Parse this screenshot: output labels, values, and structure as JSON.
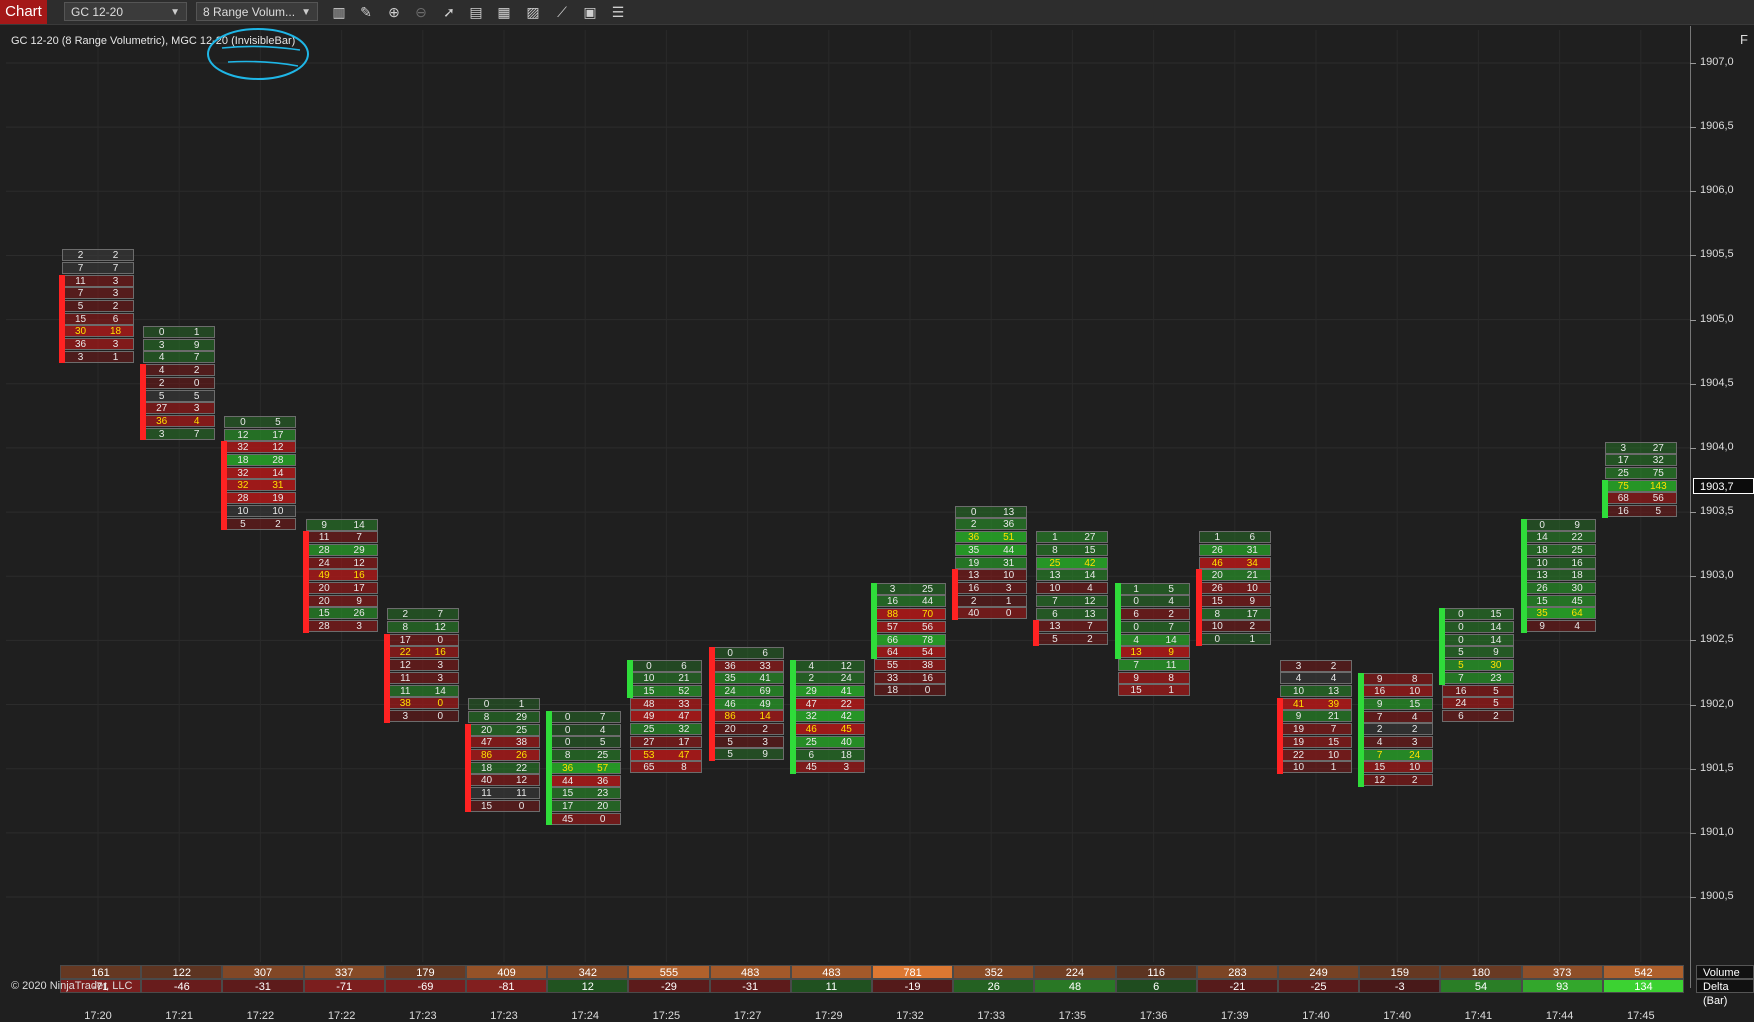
{
  "toolbar": {
    "app_tab": "Chart",
    "instrument": "GC 12-20",
    "bar_type": "8 Range Volum...",
    "icons": [
      "data-series-icon",
      "draw-icon",
      "zoom-in-icon",
      "zoom-out-icon",
      "pointer-icon",
      "properties-icon",
      "templates-icon",
      "indicators-icon",
      "strategies-icon",
      "snapshot-icon",
      "chart-trader-icon"
    ]
  },
  "chart": {
    "label": "GC 12-20 (8 Range Volumetric), MGC 12-20 (InvisibleBar)",
    "f_button": "F",
    "copyright": "© 2020 NinjaTrader, LLC",
    "current_price": "1903,7",
    "annotation_color": "#1fb6e6"
  },
  "chart_data": {
    "type": "volumetric-footprint",
    "y_ticks": [
      "1907,0",
      "1906,5",
      "1906,0",
      "1905,5",
      "1905,0",
      "1904,5",
      "1904,0",
      "1903,5",
      "1903,0",
      "1902,5",
      "1902,0",
      "1901,5",
      "1901,0",
      "1900,5"
    ],
    "ylim": [
      1900.5,
      1907.0
    ],
    "x_ticks": [
      "17:20",
      "17:21",
      "17:22",
      "17:22",
      "17:23",
      "17:23",
      "17:24",
      "17:25",
      "17:27",
      "17:29",
      "17:32",
      "17:33",
      "17:35",
      "17:36",
      "17:39",
      "17:40",
      "17:40",
      "17:41",
      "17:44",
      "17:45"
    ],
    "bars": [
      {
        "high": 1905.5,
        "dir": "down",
        "rows": [
          [
            2,
            2
          ],
          [
            7,
            7
          ],
          [
            11,
            3
          ],
          [
            7,
            3
          ],
          [
            5,
            2
          ],
          [
            15,
            6
          ],
          [
            30,
            18
          ],
          [
            36,
            3
          ],
          [
            3,
            1
          ]
        ],
        "hi": [
          6
        ],
        "candle": [
          2,
          8
        ]
      },
      {
        "high": 1904.9,
        "dir": "down",
        "rows": [
          [
            0,
            1
          ],
          [
            3,
            9
          ],
          [
            4,
            7
          ],
          [
            4,
            2
          ],
          [
            2,
            0
          ],
          [
            5,
            5
          ],
          [
            27,
            3
          ],
          [
            36,
            4
          ],
          [
            3,
            7
          ]
        ],
        "hi": [
          7
        ],
        "candle": [
          3,
          8
        ]
      },
      {
        "high": 1904.2,
        "dir": "down",
        "rows": [
          [
            0,
            5
          ],
          [
            12,
            17
          ],
          [
            32,
            12
          ],
          [
            18,
            28
          ],
          [
            32,
            14
          ],
          [
            32,
            31
          ],
          [
            28,
            19
          ],
          [
            10,
            10
          ],
          [
            5,
            2
          ]
        ],
        "hi": [
          5
        ],
        "candle": [
          2,
          8
        ]
      },
      {
        "high": 1903.4,
        "dir": "down",
        "rows": [
          [
            9,
            14
          ],
          [
            11,
            7
          ],
          [
            28,
            29
          ],
          [
            24,
            12
          ],
          [
            49,
            16
          ],
          [
            20,
            17
          ],
          [
            20,
            9
          ],
          [
            15,
            26
          ],
          [
            28,
            3
          ]
        ],
        "hi": [
          4
        ],
        "candle": [
          1,
          8
        ]
      },
      {
        "high": 1902.7,
        "dir": "down",
        "rows": [
          [
            2,
            7
          ],
          [
            8,
            12
          ],
          [
            17,
            0
          ],
          [
            22,
            16
          ],
          [
            12,
            3
          ],
          [
            11,
            3
          ],
          [
            11,
            14
          ],
          [
            38,
            0
          ],
          [
            3,
            0
          ]
        ],
        "hi": [
          3,
          7
        ],
        "candle": [
          2,
          8
        ]
      },
      {
        "high": 1902.0,
        "dir": "down",
        "rows": [
          [
            0,
            1
          ],
          [
            8,
            29
          ],
          [
            20,
            25
          ],
          [
            47,
            38
          ],
          [
            86,
            26
          ],
          [
            18,
            22
          ],
          [
            40,
            12
          ],
          [
            11,
            11
          ],
          [
            15,
            0
          ]
        ],
        "hi": [
          4
        ],
        "candle": [
          2,
          8
        ]
      },
      {
        "high": 1901.9,
        "dir": "up",
        "rows": [
          [
            0,
            7
          ],
          [
            0,
            4
          ],
          [
            0,
            5
          ],
          [
            8,
            25
          ],
          [
            36,
            57
          ],
          [
            44,
            36
          ],
          [
            15,
            23
          ],
          [
            17,
            20
          ],
          [
            45,
            0
          ]
        ],
        "hi": [
          4
        ],
        "candle": [
          0,
          8
        ]
      },
      {
        "high": 1902.3,
        "dir": "up",
        "rows": [
          [
            0,
            6
          ],
          [
            10,
            21
          ],
          [
            15,
            52
          ],
          [
            48,
            33
          ],
          [
            49,
            47
          ],
          [
            25,
            32
          ],
          [
            27,
            17
          ],
          [
            53,
            47
          ],
          [
            65,
            8
          ]
        ],
        "hi": [
          7
        ],
        "candle": [
          0,
          2
        ]
      },
      {
        "high": 1902.4,
        "dir": "down",
        "rows": [
          [
            0,
            6
          ],
          [
            36,
            33
          ],
          [
            35,
            41
          ],
          [
            24,
            69
          ],
          [
            46,
            49
          ],
          [
            86,
            14
          ],
          [
            20,
            2
          ],
          [
            5,
            3
          ],
          [
            5,
            9
          ]
        ],
        "hi": [
          5
        ],
        "candle": [
          0,
          8
        ]
      },
      {
        "high": 1902.3,
        "dir": "up",
        "rows": [
          [
            4,
            12
          ],
          [
            2,
            24
          ],
          [
            29,
            41
          ],
          [
            47,
            22
          ],
          [
            32,
            42
          ],
          [
            46,
            45
          ],
          [
            25,
            40
          ],
          [
            6,
            18
          ],
          [
            45,
            3
          ]
        ],
        "hi": [
          5
        ],
        "candle": [
          0,
          8
        ]
      },
      {
        "high": 1902.9,
        "dir": "up",
        "rows": [
          [
            3,
            25
          ],
          [
            16,
            44
          ],
          [
            88,
            70
          ],
          [
            57,
            56
          ],
          [
            66,
            78
          ],
          [
            64,
            54
          ],
          [
            55,
            38
          ],
          [
            33,
            16
          ],
          [
            18,
            0
          ]
        ],
        "hi": [
          2
        ],
        "candle": [
          0,
          5
        ]
      },
      {
        "high": 1903.5,
        "dir": "down",
        "rows": [
          [
            0,
            13
          ],
          [
            2,
            36
          ],
          [
            36,
            51
          ],
          [
            35,
            44
          ],
          [
            19,
            31
          ],
          [
            13,
            10
          ],
          [
            16,
            3
          ],
          [
            2,
            1
          ],
          [
            40,
            0
          ]
        ],
        "hi": [
          2
        ],
        "candle": [
          5,
          8
        ]
      },
      {
        "high": 1903.3,
        "dir": "down",
        "rows": [
          [
            1,
            27
          ],
          [
            8,
            15
          ],
          [
            25,
            42
          ],
          [
            13,
            14
          ],
          [
            10,
            4
          ],
          [
            7,
            12
          ],
          [
            6,
            13
          ],
          [
            13,
            7
          ],
          [
            5,
            2
          ]
        ],
        "hi": [
          2
        ],
        "candle": [
          7,
          8
        ]
      },
      {
        "high": 1902.9,
        "dir": "up",
        "rows": [
          [
            1,
            5
          ],
          [
            0,
            4
          ],
          [
            6,
            2
          ],
          [
            0,
            7
          ],
          [
            4,
            14
          ],
          [
            13,
            9
          ],
          [
            7,
            11
          ],
          [
            9,
            8
          ],
          [
            15,
            1
          ]
        ],
        "hi": [
          5
        ],
        "candle": [
          0,
          5
        ]
      },
      {
        "high": 1903.3,
        "dir": "down",
        "rows": [
          [
            1,
            6
          ],
          [
            26,
            31
          ],
          [
            46,
            34
          ],
          [
            20,
            21
          ],
          [
            26,
            10
          ],
          [
            15,
            9
          ],
          [
            8,
            17
          ],
          [
            10,
            2
          ],
          [
            0,
            1
          ]
        ],
        "hi": [
          2
        ],
        "candle": [
          3,
          8
        ]
      },
      {
        "high": 1902.3,
        "dir": "down",
        "rows": [
          [
            3,
            2
          ],
          [
            4,
            4
          ],
          [
            10,
            13
          ],
          [
            41,
            39
          ],
          [
            9,
            21
          ],
          [
            19,
            7
          ],
          [
            19,
            15
          ],
          [
            22,
            10
          ],
          [
            10,
            1
          ]
        ],
        "hi": [
          3
        ],
        "candle": [
          3,
          8
        ]
      },
      {
        "high": 1902.2,
        "dir": "up",
        "rows": [
          [
            9,
            8
          ],
          [
            16,
            10
          ],
          [
            9,
            15
          ],
          [
            7,
            4
          ],
          [
            2,
            2
          ],
          [
            4,
            3
          ],
          [
            7,
            24
          ],
          [
            15,
            10
          ],
          [
            12,
            2
          ]
        ],
        "hi": [
          6
        ],
        "candle": [
          0,
          8
        ]
      },
      {
        "high": 1902.7,
        "dir": "up",
        "rows": [
          [
            0,
            15
          ],
          [
            0,
            14
          ],
          [
            0,
            14
          ],
          [
            5,
            9
          ],
          [
            5,
            30
          ],
          [
            7,
            23
          ],
          [
            16,
            5
          ],
          [
            24,
            5
          ],
          [
            6,
            2
          ]
        ],
        "hi": [
          4
        ],
        "candle": [
          0,
          5
        ]
      },
      {
        "high": 1903.4,
        "dir": "up",
        "rows": [
          [
            0,
            9
          ],
          [
            14,
            22
          ],
          [
            18,
            25
          ],
          [
            10,
            16
          ],
          [
            13,
            18
          ],
          [
            26,
            30
          ],
          [
            15,
            45
          ],
          [
            35,
            64
          ],
          [
            9,
            4
          ]
        ],
        "hi": [
          7
        ],
        "candle": [
          0,
          8
        ]
      },
      {
        "high": 1904.0,
        "dir": "up",
        "rows": [
          [
            3,
            27
          ],
          [
            17,
            32
          ],
          [
            25,
            75
          ],
          [
            75,
            143
          ],
          [
            68,
            56
          ],
          [
            16,
            5
          ]
        ],
        "hi": [
          3
        ],
        "candle": [
          3,
          5
        ]
      }
    ],
    "volume_label": "Volume",
    "delta_label": "Delta (Bar)",
    "volume": [
      161,
      122,
      307,
      337,
      179,
      409,
      342,
      555,
      483,
      483,
      781,
      352,
      224,
      116,
      283,
      249,
      159,
      180,
      373,
      542
    ],
    "delta": [
      -71,
      -46,
      -31,
      -71,
      -69,
      -81,
      12,
      -29,
      -31,
      11,
      -19,
      26,
      48,
      6,
      -21,
      -25,
      -3,
      54,
      93,
      134
    ]
  }
}
